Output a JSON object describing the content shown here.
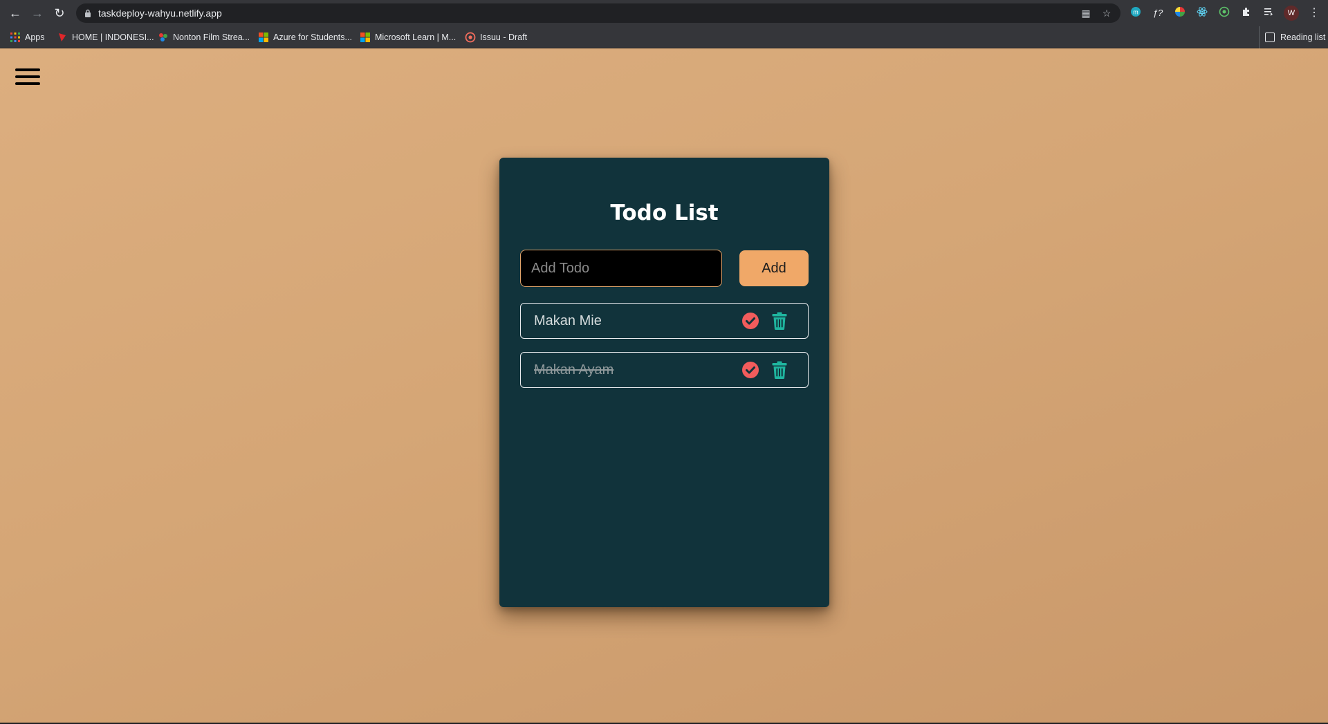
{
  "browser": {
    "url": "taskdeploy-wahyu.netlify.app",
    "bookmarks": [
      {
        "label": "Apps",
        "icon": "apps-grid-icon"
      },
      {
        "label": "HOME | INDONESI...",
        "icon": "indonesia-favicon-icon"
      },
      {
        "label": "Nonton Film Strea...",
        "icon": "film-favicon-icon"
      },
      {
        "label": "Azure for Students...",
        "icon": "microsoft-logo-icon"
      },
      {
        "label": "Microsoft Learn | M...",
        "icon": "microsoft-logo-icon"
      },
      {
        "label": "Issuu - Draft",
        "icon": "issuu-icon"
      }
    ],
    "reading_list": "Reading list",
    "profile_initial": "W"
  },
  "app": {
    "title": "Todo List",
    "input_placeholder": "Add Todo",
    "add_label": "Add",
    "todos": [
      {
        "text": "Makan Mie",
        "completed": false
      },
      {
        "text": "Makan Ayam",
        "completed": true
      }
    ]
  },
  "colors": {
    "card_bg": "#11333b",
    "accent": "#f0a868",
    "check": "#f25c5c",
    "trash": "#1fb59f",
    "page_bg": "#d5a676"
  }
}
